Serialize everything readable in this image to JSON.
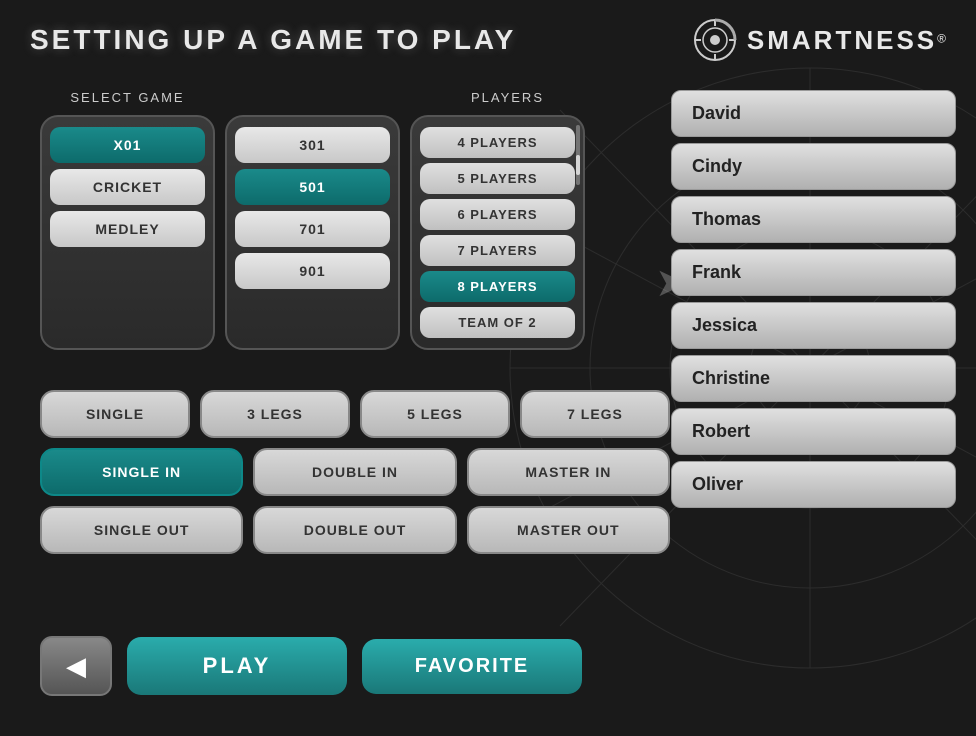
{
  "header": {
    "title": "SETTING UP A GAME TO PLAY",
    "logo_text": "SMARTNESS",
    "logo_reg": "®"
  },
  "select_game": {
    "label": "SELECT GAME",
    "games": [
      {
        "label": "X01",
        "active": true
      },
      {
        "label": "CRICKET",
        "active": false
      },
      {
        "label": "MEDLEY",
        "active": false
      }
    ],
    "scores": [
      {
        "label": "301",
        "active": false
      },
      {
        "label": "501",
        "active": true
      },
      {
        "label": "701",
        "active": false
      },
      {
        "label": "901",
        "active": false
      }
    ]
  },
  "players_select": {
    "label": "PLAYERS",
    "options": [
      {
        "label": "4 PLAYERS",
        "active": false
      },
      {
        "label": "5 PLAYERS",
        "active": false
      },
      {
        "label": "6 PLAYERS",
        "active": false
      },
      {
        "label": "7 PLAYERS",
        "active": false
      },
      {
        "label": "8 PLAYERS",
        "active": true
      },
      {
        "label": "TEAM OF 2",
        "active": false
      }
    ]
  },
  "options": {
    "legs": [
      {
        "label": "SINGLE",
        "active": false
      },
      {
        "label": "3 LEGS",
        "active": false
      },
      {
        "label": "5 LEGS",
        "active": false
      },
      {
        "label": "7 LEGS",
        "active": false
      }
    ],
    "in": [
      {
        "label": "SINGLE IN",
        "active": true
      },
      {
        "label": "DOUBLE IN",
        "active": false
      },
      {
        "label": "MASTER IN",
        "active": false
      }
    ],
    "out": [
      {
        "label": "SINGLE OUT",
        "active": false
      },
      {
        "label": "DOUBLE OUT",
        "active": false
      },
      {
        "label": "MASTER OUT",
        "active": false
      }
    ]
  },
  "buttons": {
    "back": "◀",
    "play": "PLAY",
    "favorite": "FAVORITE"
  },
  "players_list": [
    {
      "name": "David"
    },
    {
      "name": "Cindy"
    },
    {
      "name": "Thomas"
    },
    {
      "name": "Frank"
    },
    {
      "name": "Jessica"
    },
    {
      "name": "Christine"
    },
    {
      "name": "Robert"
    },
    {
      "name": "Oliver"
    }
  ]
}
